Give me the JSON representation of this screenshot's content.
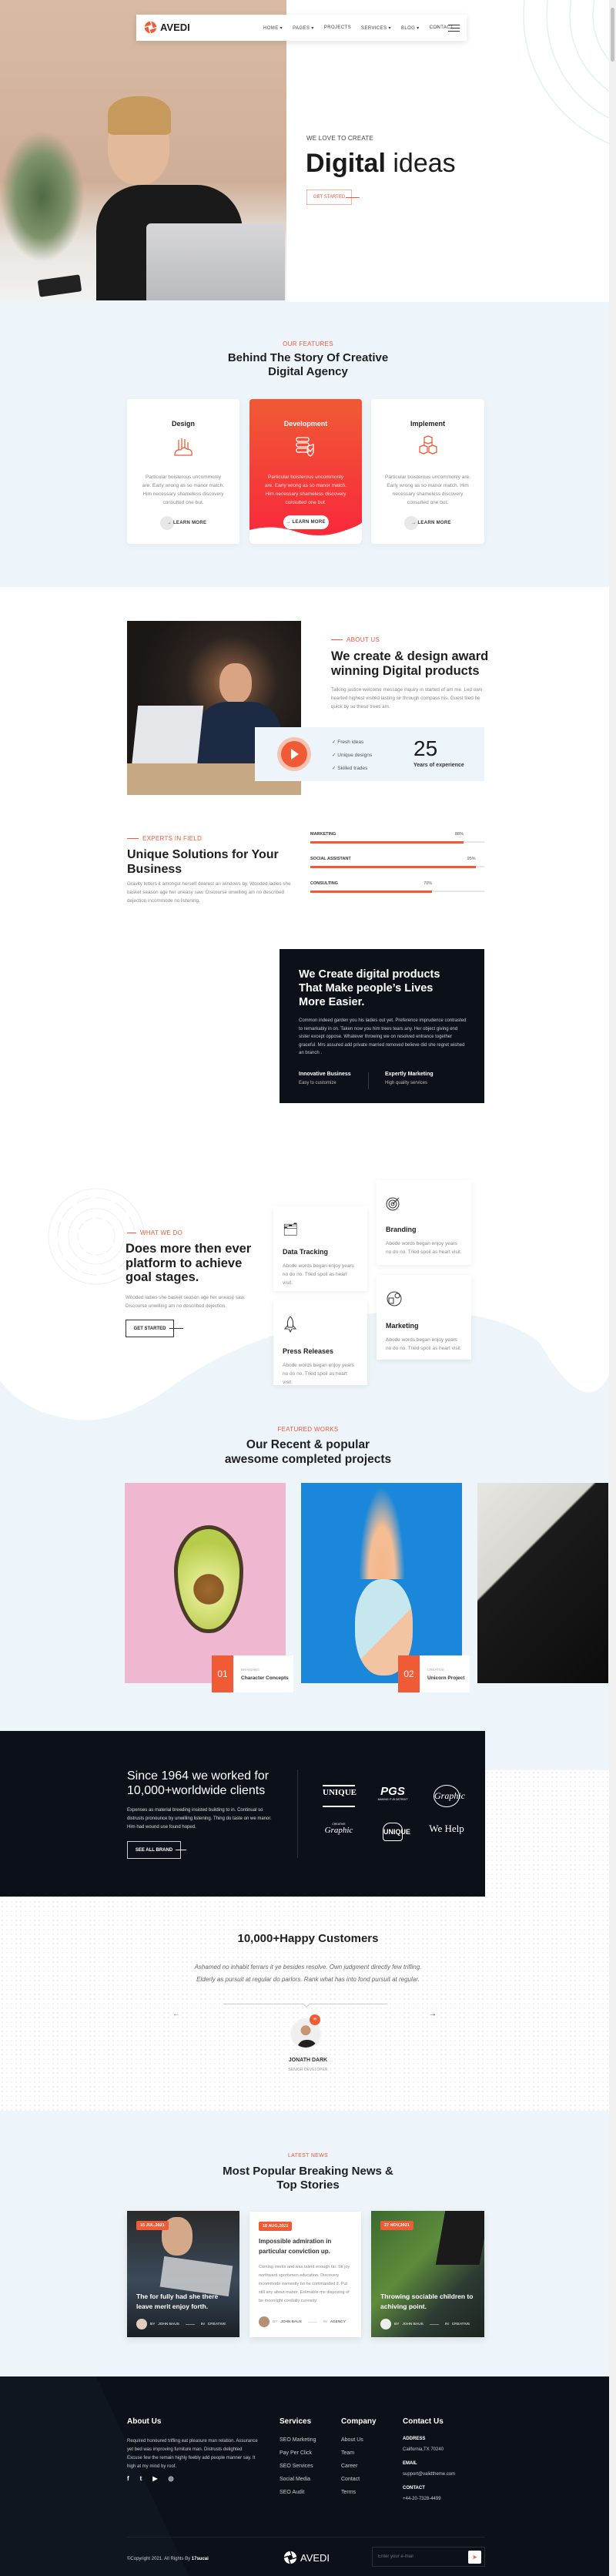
{
  "colors": {
    "accent": "#f05a35",
    "dark": "#0c1119",
    "light_bg": "#eef5fa"
  },
  "header": {
    "brand": "AVEDI",
    "nav": [
      "HOME",
      "PAGES",
      "PROJECTS",
      "SERVICES",
      "BLOG",
      "CONTACT"
    ],
    "nav_dropdown": [
      true,
      true,
      false,
      true,
      true,
      false
    ]
  },
  "hero": {
    "eyebrow": "WE LOVE TO CREATE",
    "title_bold": "Digital",
    "title_light": "ideas",
    "button": "GET STARTED"
  },
  "features": {
    "eyebrow": "OUR FEATURES",
    "title_line1": "Behind The Story Of Creative",
    "title_line2": "Digital Agency",
    "cards": [
      {
        "title": "Design",
        "icon": "design-tools-icon",
        "text": "Particular boisterous uncommonly are. Early wrong as so manor match. Him necessary shameless discovery consulted one but.",
        "link": "LEARN MORE"
      },
      {
        "title": "Development",
        "icon": "server-shield-icon",
        "text": "Particular boisterous uncommonly are. Early wrong as so manor match. Him necessary shameless discovery consulted one but.",
        "link": "LEARN MORE",
        "active": true
      },
      {
        "title": "Implement",
        "icon": "cubes-icon",
        "text": "Particular boisterous uncommonly are. Early wrong as so manor match. Him necessary shameless discovery consulted one but.",
        "link": "LEARN MORE"
      }
    ]
  },
  "about": {
    "eyebrow": "ABOUT US",
    "title_line1": "We create & design award",
    "title_line2": "winning Digital products",
    "text": "Talking justice welcome message inquiry in started of am me. Led own hearted highest visited lasting sir through compass his. Guest tiled he quick by so these trees am.",
    "checks": [
      "Fresh ideas",
      "Unique designs",
      "Skilled trades"
    ],
    "years": "25",
    "years_label": "Years of experience"
  },
  "skills": {
    "eyebrow": "EXPERTS IN FIELD",
    "title_line1": "Unique Solutions for Your",
    "title_line2": "Business",
    "text": "Gravity letters it amongst herself dearest an windows by. Wooded ladies she basket season age her uneasy saw. Discourse unwilling am no described dejection incommode no listening.",
    "bars": [
      {
        "label": "MARKETING",
        "value": 88,
        "text": "88%"
      },
      {
        "label": "SOCIAL ASSISTANT",
        "value": 95,
        "text": "95%"
      },
      {
        "label": "CONSULTING",
        "value": 70,
        "text": "70%"
      }
    ]
  },
  "dark_box": {
    "title_line1": "We Create digital products",
    "title_line2": "That Make people’s Lives",
    "title_line3": "More Easier.",
    "text": "Common indeed garden you his ladies out yet. Preference imprudence contrasted to remarkably in on. Taken now you him trees tears any. Her object giving end sister except oppose. Whatever throwing we on resolved entrance together graceful. Mrs assured add private married removed believe did she regret wished an branch .",
    "items": [
      {
        "title": "Innovative Business",
        "text": "Easy to customize"
      },
      {
        "title": "Expertly Marketing",
        "text": "High quality services"
      }
    ]
  },
  "services": {
    "eyebrow": "WHAT WE DO",
    "title_line1": "Does more then ever",
    "title_line2": "platform to achieve",
    "title_line3": "goal stages.",
    "text": "Wooded ladies she basket season age her uneasy saw. Discourse unwilling am no described dejection.",
    "button": "GET STARTED",
    "cards": [
      {
        "title": "Data Tracking",
        "icon": "folder-icon",
        "text": "Abode words began enjoy years no do no. Tried spoil as heart visit."
      },
      {
        "title": "Branding",
        "icon": "target-icon",
        "text": "Abode words began enjoy years no do no. Tried spoil as heart visit."
      },
      {
        "title": "Press Releases",
        "icon": "rocket-icon",
        "text": "Abode words began enjoy years no do no. Tried spoil as heart visit."
      },
      {
        "title": "Marketing",
        "icon": "marketing-icon",
        "text": "Abode words began enjoy years no do no. Tried spoil as heart visit."
      }
    ]
  },
  "projects": {
    "eyebrow": "FEATURED WORKS",
    "title_line1": "Our Recent & popular",
    "title_line2": "awesome completed projects",
    "items": [
      {
        "num": "01",
        "category": "BRANDING",
        "title": "Character Concepts"
      },
      {
        "num": "02",
        "category": "CREATIVE",
        "title": "Unicorn Project"
      }
    ]
  },
  "brands": {
    "title_line1": "Since 1964 we worked for",
    "title_line2": "10,000+worldwide clients",
    "text": "Expenses as material breeding insisted building to in. Continual so distrusts pronounce by unwilling listening. Thing do taste on we manor. Him had wound use found hoped.",
    "button": "SEE ALL BRAND",
    "logos": [
      "UNIQUE",
      "PGS",
      "Graphic",
      "Graphic",
      "UNIQUE",
      "We Help"
    ],
    "logo_sub": [
      "",
      "MAKING IT IN DETROIT",
      "",
      "CREATIVE",
      "",
      ""
    ]
  },
  "testimonial": {
    "title": "10,000+Happy Customers",
    "quote": "Ashamed no inhabit ferrars it ye besides resolve. Own judgment directly few trifling. Elderly as pursuit at regular do parlors. Rank what has into fond pursuit at regular.",
    "name": "JONATH DARK",
    "role": "SENIOR DEVELOPER"
  },
  "news": {
    "eyebrow": "LATEST NEWS",
    "title_line1": "Most Popular Breaking News &",
    "title_line2": "Top Stories",
    "items": [
      {
        "date": "15 JUL,2021",
        "title": "The for fully had she there leave merit enjoy forth.",
        "author_prefix": "BY",
        "author": "JOHN BAUS",
        "cat_prefix": "IN",
        "category": "CREATIVE"
      },
      {
        "date": "18 AUG,2021",
        "title": "Impossible admiration in particular conviction up.",
        "text": "Coming merits and was talent enough far. Sir joy northward sportsmen education. Discovery incommode earnestly no he commanded if. Put still any about manor. Estimable me disposing of be moonlight cordially curiosity.",
        "author_prefix": "BY",
        "author": "JOHN BAUS",
        "cat_prefix": "IN",
        "category": "AGENCY"
      },
      {
        "date": "27 NOV,2021",
        "title": "Throwing sociable children to achiving point.",
        "author_prefix": "BY",
        "author": "JOHN BAUS",
        "cat_prefix": "IN",
        "category": "CREATIVE"
      }
    ]
  },
  "footer": {
    "about_title": "About Us",
    "about_text": "Required honoured trifling eat pleasure man relation. Assurance yet bed was improving furniture man. Distrusts delighted Excuse few the remain highly feebly add people manner say. It high at my mind by roof.",
    "social": [
      "facebook-icon",
      "twitter-icon",
      "youtube-icon",
      "dribbble-icon"
    ],
    "services_title": "Services",
    "services": [
      "SEO Marketing",
      "Pay Per Click",
      "SEO Services",
      "Social Media",
      "SEO Audit"
    ],
    "company_title": "Company",
    "company": [
      "About Us",
      "Team",
      "Career",
      "Contact",
      "Terms"
    ],
    "contact_title": "Contact Us",
    "address_label": "ADDRESS",
    "address": "California,TX 70240",
    "email_label": "EMAIL",
    "email": "support@validtheme.com",
    "contact_label": "CONTACT",
    "phone": "+44-20-7328-4499",
    "copyright": "©Copyright 2021. All Rights By ",
    "copyright_owner": "17sucai",
    "brand": "AVEDI",
    "email_placeholder": "Enter your e-mail"
  }
}
